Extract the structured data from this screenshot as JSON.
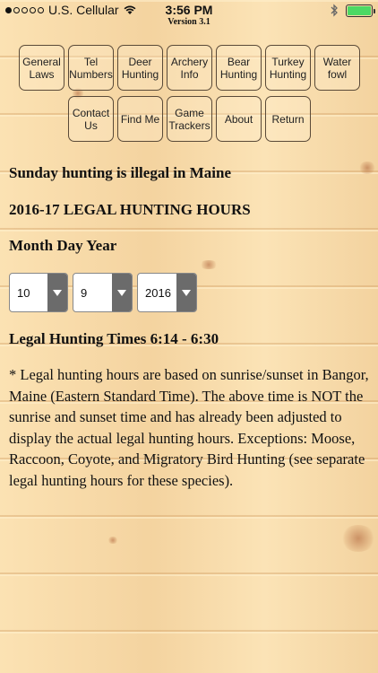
{
  "status_bar": {
    "carrier": "U.S. Cellular",
    "time": "3:56 PM",
    "version": "Version 3.1",
    "signal_dots_filled": 1,
    "signal_dots_total": 5,
    "battery_level": 1.0,
    "battery_color": "#4cd964"
  },
  "nav": {
    "row1": [
      "General\nLaws",
      "Tel\nNumbers",
      "Deer\nHunting",
      "Archery\nInfo",
      "Bear\nHunting",
      "Turkey\nHunting",
      "Water\nfowl"
    ],
    "row2": [
      "Contact\nUs",
      "Find Me",
      "Game\nTrackers",
      "About",
      "Return"
    ]
  },
  "content": {
    "sunday_notice": "Sunday hunting is illegal in Maine",
    "hours_heading": "2016-17 LEGAL HUNTING HOURS",
    "date_label": "Month Day Year",
    "month_value": "10",
    "day_value": "9",
    "year_value": "2016",
    "legal_times": "Legal Hunting Times 6:14 - 6:30",
    "note": "* Legal hunting hours are based on sunrise/sunset in Bangor, Maine (Eastern Standard Time). The above time is NOT the sunrise and sunset time and has already been adjusted to display the actual legal hunting hours. Exceptions: Moose, Raccoon, Coyote, and Migratory Bird Hunting (see separate legal hunting hours for these species)."
  }
}
